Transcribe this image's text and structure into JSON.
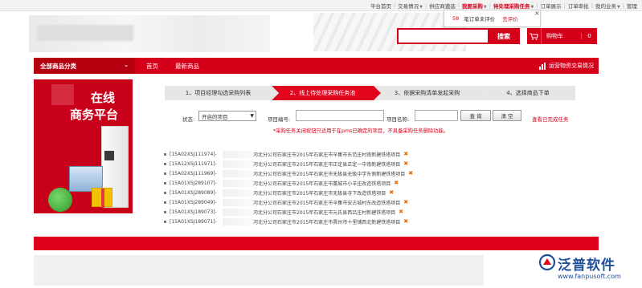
{
  "topnav": {
    "items": [
      "平台首页",
      "交易情况",
      "供应商遴选",
      "我要采购",
      "待处理采购任务",
      "订单展示",
      "订单审批",
      "我的业务",
      "管理"
    ],
    "red_indices": [
      3,
      4
    ]
  },
  "popup": {
    "count": "58",
    "text": "笔订单未评价",
    "link": "去评价",
    "close": "×"
  },
  "header": {
    "search_button": "搜索",
    "cart_label": "购物车",
    "cart_count": "0"
  },
  "nav": {
    "category_label": "全部商品分类",
    "links": [
      "首页",
      "最新商品"
    ],
    "extra": "运营物资交易情况"
  },
  "banner": {
    "line1": "在线",
    "line2": "商务平台"
  },
  "steps": [
    {
      "label": "1、项目经理勾选采购列表",
      "active": false
    },
    {
      "label": "2、线上待处理采购任务池",
      "active": true
    },
    {
      "label": "3、依据采购清单发起采购",
      "active": false
    },
    {
      "label": "4、选择商品下单",
      "active": false
    }
  ],
  "filter": {
    "status_label": "状态:",
    "status_value": "开启的项目",
    "project_no_label": "项目编号:",
    "project_name_label": "项目名称:",
    "search_button": "查 询",
    "clear_button": "清 空",
    "view_done": "查看已完成任务",
    "notice": "*采购任务关闭按钮只适用于在pms已确定的项目，不具备采购任务删除功能。"
  },
  "projects": [
    {
      "code": "[15A02XSJ111974]-",
      "name": "河北分公司石家庄市2015年石家庄市辛集市东范庄村南新建铁塔项目"
    },
    {
      "code": "[15A12XSJ111971]-",
      "name": "河北分公司石家庄市2015年石家庄市正定县正定一中南新建铁塔项目"
    },
    {
      "code": "[15A02XSJ111969]-",
      "name": "河北分公司石家庄市2015年石家庄市无极县无极中学东侧新建铁塔项目"
    },
    {
      "code": "[15A01XSJ289107]-",
      "name": "河北分公司石家庄市2015年石家庄市藁城市小羊庄改造铁塔项目"
    },
    {
      "code": "[15A01XSJ289089]-",
      "name": "河北分公司石家庄市2015年石家庄市无极县寺下改造铁塔项目"
    },
    {
      "code": "[15A01XSJ289049]-",
      "name": "河北分公司石家庄市2015年石家庄市辛集市安古城村东改造铁塔项目"
    },
    {
      "code": "[15A01XSJ189073]-",
      "name": "河北分公司石家庄市2015年石家庄市元氏县西吕庄村新建铁塔项目"
    },
    {
      "code": "[15A01XSJ189071]-",
      "name": "河北分公司石家庄市2015年石家庄市晋州市十里铺西北新建铁塔项目"
    }
  ],
  "brand": {
    "name": "泛普软件",
    "url": "www.fanpusoft.com"
  },
  "colors": {
    "brand_red": "#d4001a",
    "step_active": "#e2051e",
    "brand_blue": "#1e4f9c"
  }
}
